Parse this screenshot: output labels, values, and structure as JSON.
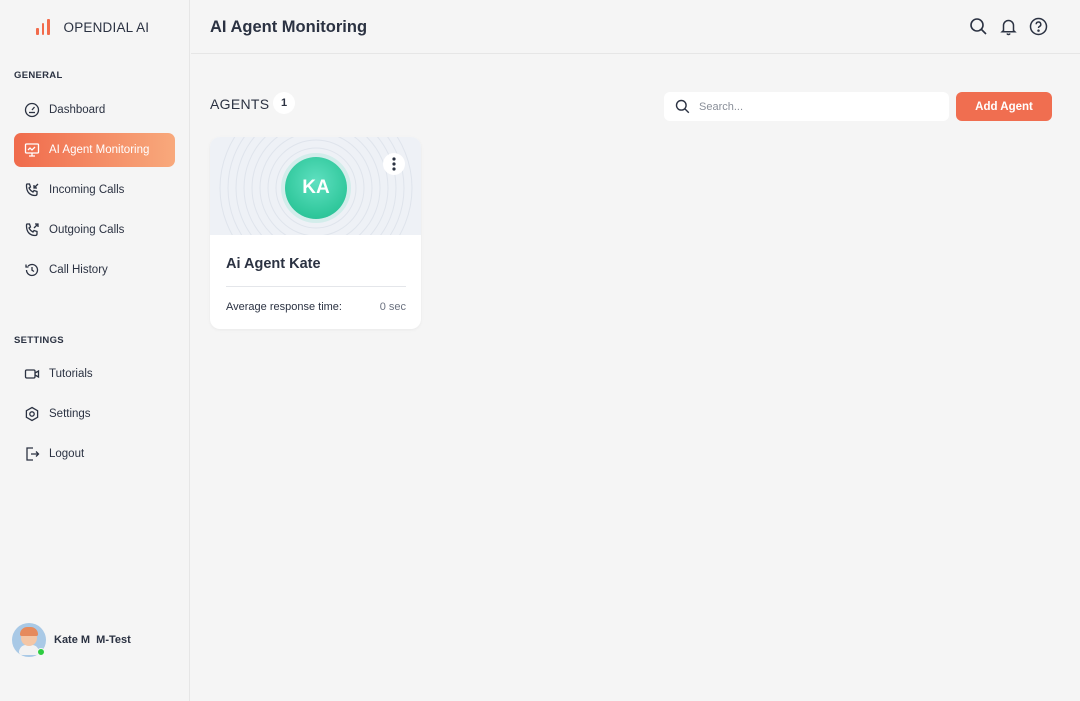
{
  "brand": {
    "name": "OPENDIAL AI",
    "accent": "#f26b4b"
  },
  "sidebar": {
    "general_label": "GENERAL",
    "settings_label": "SETTINGS",
    "general_items": [
      {
        "label": "Dashboard",
        "icon": "gauge-icon"
      },
      {
        "label": "AI Agent Monitoring",
        "icon": "monitor-icon",
        "active": true
      },
      {
        "label": "Incoming Calls",
        "icon": "phone-incoming-icon"
      },
      {
        "label": "Outgoing Calls",
        "icon": "phone-outgoing-icon"
      },
      {
        "label": "Call History",
        "icon": "history-icon"
      }
    ],
    "settings_items": [
      {
        "label": "Tutorials",
        "icon": "video-icon"
      },
      {
        "label": "Settings",
        "icon": "hexagon-gear-icon"
      },
      {
        "label": "Logout",
        "icon": "logout-icon"
      }
    ],
    "user": {
      "name": "Kate M  M-Test",
      "status": "online"
    }
  },
  "header": {
    "title": "AI Agent Monitoring",
    "icons": [
      "search-icon",
      "bell-icon",
      "help-icon"
    ]
  },
  "agents": {
    "label": "AGENTS",
    "count": "1",
    "search_placeholder": "Search...",
    "add_button": "Add Agent",
    "list": [
      {
        "initials": "KA",
        "name": "Ai Agent Kate",
        "metric_label": "Average response time:",
        "metric_value": "0 sec"
      }
    ]
  },
  "colors": {
    "active_gradient_start": "#f06b4c",
    "active_gradient_end": "#f8a97c",
    "add_button": "#f06e50",
    "agent_avatar": "#2fc79b",
    "online": "#2ecc40"
  }
}
